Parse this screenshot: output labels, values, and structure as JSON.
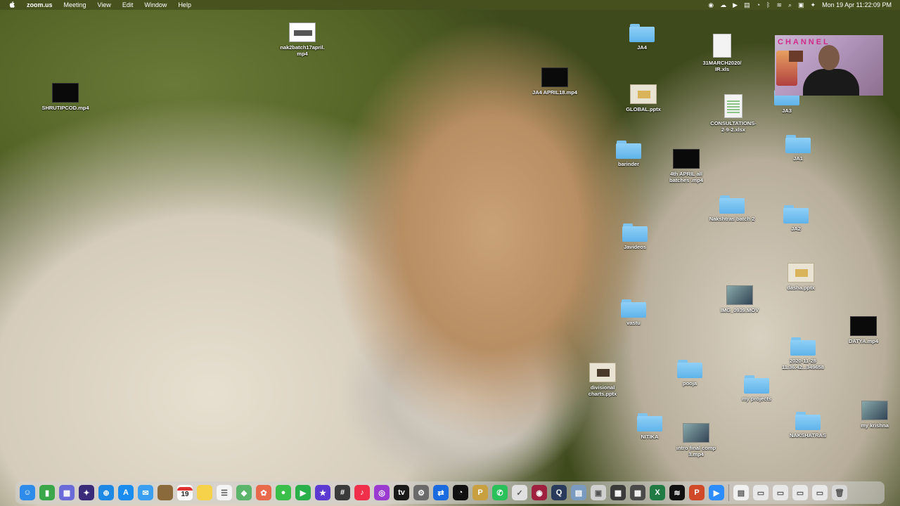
{
  "menubar": {
    "app_name": "zoom.us",
    "menus": [
      "Meeting",
      "View",
      "Edit",
      "Window",
      "Help"
    ],
    "clock": "Mon 19 Apr  11:22:09 PM"
  },
  "desktop": {
    "items": [
      {
        "label": "nak2batch17april.\nmp4",
        "kind": "screen",
        "name": "file-nak2batch17april"
      },
      {
        "label": "SHRUTIPCOD.mp4",
        "kind": "video",
        "name": "file-shrutipcod"
      },
      {
        "label": "JA4 APRIL18.mp4",
        "kind": "video",
        "name": "file-ja4-april18"
      },
      {
        "label": "JA4",
        "kind": "folder",
        "name": "folder-ja4"
      },
      {
        "label": "31MARCH2020/\nIR.xls",
        "kind": "doc",
        "name": "file-31march2020"
      },
      {
        "label": "GLOBAL.pptx",
        "kind": "ppt",
        "name": "file-global-pptx"
      },
      {
        "label": "CONSULTATIONS-\n2-9-2.xlsx",
        "kind": "xls",
        "name": "file-consultations"
      },
      {
        "label": "JA3",
        "kind": "folder",
        "name": "folder-ja3"
      },
      {
        "label": "barinder",
        "kind": "folder",
        "name": "folder-barinder"
      },
      {
        "label": "4th APRIL  all\nbatches .mp4",
        "kind": "video",
        "name": "file-4th-april"
      },
      {
        "label": "JA1",
        "kind": "folder",
        "name": "folder-ja1"
      },
      {
        "label": "Nakshtras batch 2",
        "kind": "folder",
        "name": "folder-nakshtras-batch-2"
      },
      {
        "label": "JA2",
        "kind": "folder",
        "name": "folder-ja2"
      },
      {
        "label": "Javideos",
        "kind": "folder",
        "name": "folder-javideos"
      },
      {
        "label": "dasha.pptx",
        "kind": "ppt",
        "name": "file-dasha-pptx"
      },
      {
        "label": "IMG_0939.MOV",
        "kind": "image",
        "name": "file-img-0939"
      },
      {
        "label": "vastu",
        "kind": "folder",
        "name": "folder-vastu"
      },
      {
        "label": "2020-11-28\n11.36.42...349658",
        "kind": "folder",
        "name": "folder-2020-11-28"
      },
      {
        "label": "divisional\ncharts.pptx",
        "kind": "ppt-dark",
        "name": "file-divisional-charts"
      },
      {
        "label": "pooja",
        "kind": "folder",
        "name": "folder-pooja"
      },
      {
        "label": "my projects",
        "kind": "folder",
        "name": "folder-my-projects"
      },
      {
        "label": "NITIKA",
        "kind": "folder",
        "name": "folder-nitika"
      },
      {
        "label": "intro final comp\n3.mp4",
        "kind": "image",
        "name": "file-intro-final-comp"
      },
      {
        "label": "NAKSHATRAS",
        "kind": "folder",
        "name": "folder-nakshatras"
      },
      {
        "label": "my krishna",
        "kind": "image",
        "name": "file-my-krishna"
      },
      {
        "label": "DATYA.mp4",
        "kind": "video",
        "name": "file-datya"
      }
    ]
  },
  "zoom_self_view": {
    "overlay_text": "CHANNEL"
  },
  "dock": {
    "calendar_day": "19",
    "apps": [
      {
        "name": "finder-icon",
        "color": "#2f8bea",
        "glyph": "☺"
      },
      {
        "name": "numbers-icon",
        "color": "#3aa84a",
        "glyph": "▮"
      },
      {
        "name": "launchpad-icon",
        "color": "#6a6ad8",
        "glyph": "▦"
      },
      {
        "name": "siri-icon",
        "color": "#3a2a7a",
        "glyph": "✦"
      },
      {
        "name": "safari-icon",
        "color": "#1e88e5",
        "glyph": "⊕"
      },
      {
        "name": "app-store-icon",
        "color": "#1a8cf0",
        "glyph": "A"
      },
      {
        "name": "mail-icon",
        "color": "#3a9ff0",
        "glyph": "✉"
      },
      {
        "name": "notes-brown-icon",
        "color": "#8a6a3a",
        "glyph": ""
      },
      {
        "name": "calendar-icon",
        "color": "#ffffff",
        "glyph": ""
      },
      {
        "name": "notes-icon",
        "color": "#f5d24a",
        "glyph": ""
      },
      {
        "name": "reminders-icon",
        "color": "#f4f4f4",
        "glyph": "☰"
      },
      {
        "name": "maps-icon",
        "color": "#5ab46a",
        "glyph": "◆"
      },
      {
        "name": "photos-icon",
        "color": "#e86a4a",
        "glyph": "✿"
      },
      {
        "name": "messages-icon",
        "color": "#3ac04a",
        "glyph": "●"
      },
      {
        "name": "facetime-icon",
        "color": "#2ab04a",
        "glyph": "▶"
      },
      {
        "name": "imovie-icon",
        "color": "#5a3ad0",
        "glyph": "★"
      },
      {
        "name": "calculator-icon",
        "color": "#3a3a3a",
        "glyph": "#"
      },
      {
        "name": "music-icon",
        "color": "#f0304a",
        "glyph": "♪"
      },
      {
        "name": "podcasts-icon",
        "color": "#9a3ad0",
        "glyph": "◎"
      },
      {
        "name": "tv-icon",
        "color": "#1a1a1a",
        "glyph": "tv"
      },
      {
        "name": "system-preferences-icon",
        "color": "#6a6a6a",
        "glyph": "⚙"
      },
      {
        "name": "teamviewer-icon",
        "color": "#1a6ae0",
        "glyph": "⇄"
      },
      {
        "name": "clock-icon",
        "color": "#111111",
        "glyph": "◔"
      },
      {
        "name": "font-book-icon",
        "color": "#c8a040",
        "glyph": "P"
      },
      {
        "name": "whatsapp-icon",
        "color": "#2ac05a",
        "glyph": "✆"
      },
      {
        "name": "activity-monitor-icon",
        "color": "#e0e0e0",
        "glyph": "✓"
      },
      {
        "name": "record-icon",
        "color": "#a02040",
        "glyph": "◉"
      },
      {
        "name": "quicktime-icon",
        "color": "#2a3a5a",
        "glyph": "Q"
      },
      {
        "name": "preview-icon",
        "color": "#7a9ac0",
        "glyph": "▤"
      },
      {
        "name": "image-capture-icon",
        "color": "#d0d0d0",
        "glyph": "▣"
      },
      {
        "name": "chess-icon",
        "color": "#3a3a3a",
        "glyph": "▩"
      },
      {
        "name": "grid-app-icon",
        "color": "#4a4a4a",
        "glyph": "▦"
      },
      {
        "name": "excel-icon",
        "color": "#1f7a44",
        "glyph": "X"
      },
      {
        "name": "spotify-icon",
        "color": "#111111",
        "glyph": "≋"
      },
      {
        "name": "powerpoint-icon",
        "color": "#d04a2a",
        "glyph": "P"
      },
      {
        "name": "zoom-icon",
        "color": "#2d8cff",
        "glyph": "▶"
      },
      {
        "name": "stack-icon",
        "color": "#f0f0f0",
        "glyph": "▤"
      },
      {
        "name": "downloads-icon",
        "color": "#e8e8e8",
        "glyph": "▭"
      },
      {
        "name": "doc-stack-icon",
        "color": "#e8e8e8",
        "glyph": "▭"
      },
      {
        "name": "screenshot-stack-icon",
        "color": "#e8e8e8",
        "glyph": "▭"
      },
      {
        "name": "files-stack-icon",
        "color": "#e8e8e8",
        "glyph": "▭"
      },
      {
        "name": "trash-icon",
        "color": "#d8d8d8",
        "glyph": "🗑"
      }
    ]
  }
}
